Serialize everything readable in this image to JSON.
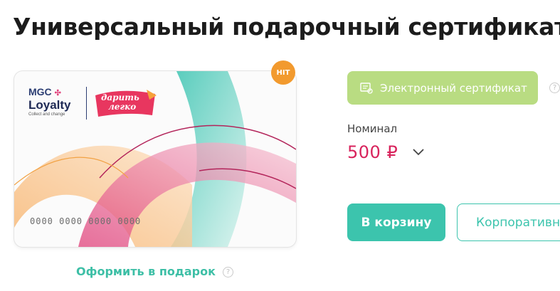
{
  "page_title": "Универсальный подарочный сертификат \"",
  "card": {
    "brand_line1": "MGC",
    "brand_line2": "Loyalty",
    "tagline": "Collect and change",
    "partner_logo_line1": "дарить",
    "partner_logo_line2": "легко",
    "card_number": "0000 0000 0000 0000"
  },
  "badge": {
    "label": "HIT",
    "color": "#f29a2e"
  },
  "gift_link": {
    "label": "Оформить в подарок"
  },
  "type_chip": {
    "label": "Электронный сертификат",
    "icon": "certificate-icon",
    "color": "#b9dc82"
  },
  "nominal": {
    "label": "Номинал",
    "value": "500 ₽"
  },
  "buttons": {
    "cart": "В корзину",
    "corporate": "Корпоративн"
  },
  "help_glyph": "?",
  "colors": {
    "accent": "#3cc4ad",
    "price": "#d8235c"
  }
}
